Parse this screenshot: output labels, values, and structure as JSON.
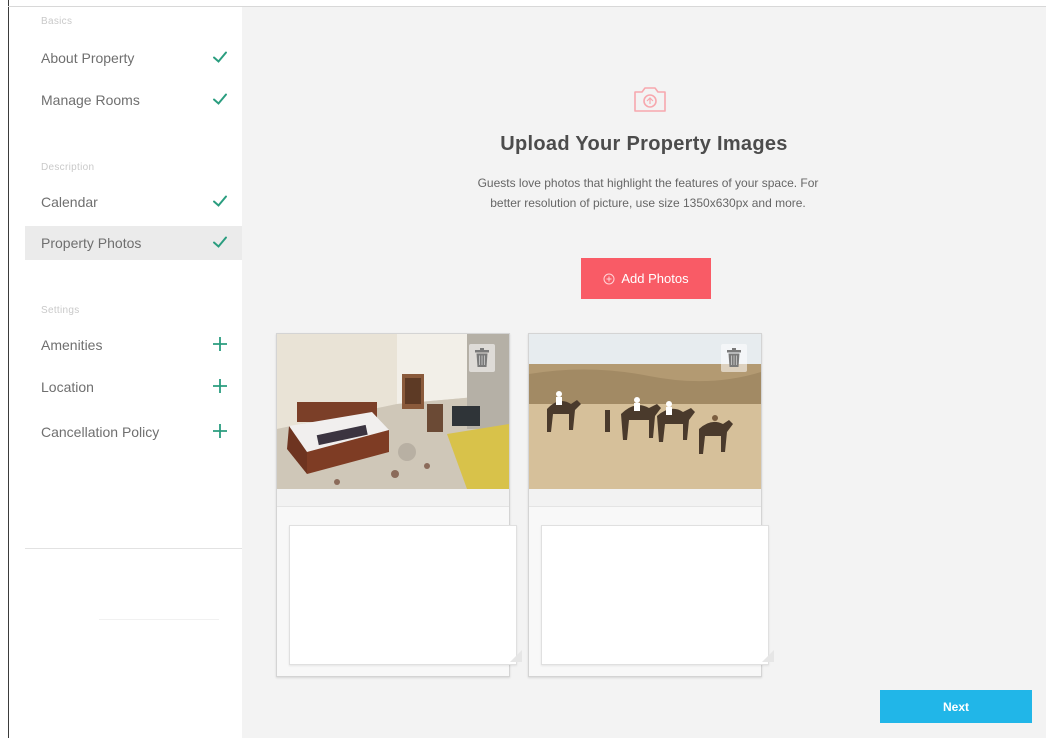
{
  "sidebar": {
    "sections": [
      {
        "label": "Basics",
        "items": [
          {
            "label": "About Property",
            "status": "check-icon"
          },
          {
            "label": "Manage Rooms",
            "status": "check-icon"
          }
        ]
      },
      {
        "label": "Description",
        "items": [
          {
            "label": "Calendar",
            "status": "check-icon"
          },
          {
            "label": "Property Photos",
            "status": "check-icon",
            "active": true
          }
        ]
      },
      {
        "label": "Settings",
        "items": [
          {
            "label": "Amenities",
            "status": "plus-icon"
          },
          {
            "label": "Location",
            "status": "plus-icon"
          },
          {
            "label": "Cancellation Policy",
            "status": "plus-icon"
          }
        ]
      }
    ]
  },
  "upload": {
    "icon": "camera-icon",
    "title": "Upload Your Property Images",
    "subtitle_line1": "Guests love photos that highlight the features of your space. For",
    "subtitle_line2": "better resolution of picture, use size 1350x630px and more.",
    "add_label": "Add Photos"
  },
  "photos": [
    {
      "subject": "hotel bedroom",
      "caption": ""
    },
    {
      "subject": "camel safari in desert",
      "caption": ""
    }
  ],
  "footer": {
    "next_label": "Next"
  },
  "colors": {
    "accent_red": "#f95b66",
    "accent_blue": "#21b6e8",
    "check_green": "#2a9d7f"
  }
}
